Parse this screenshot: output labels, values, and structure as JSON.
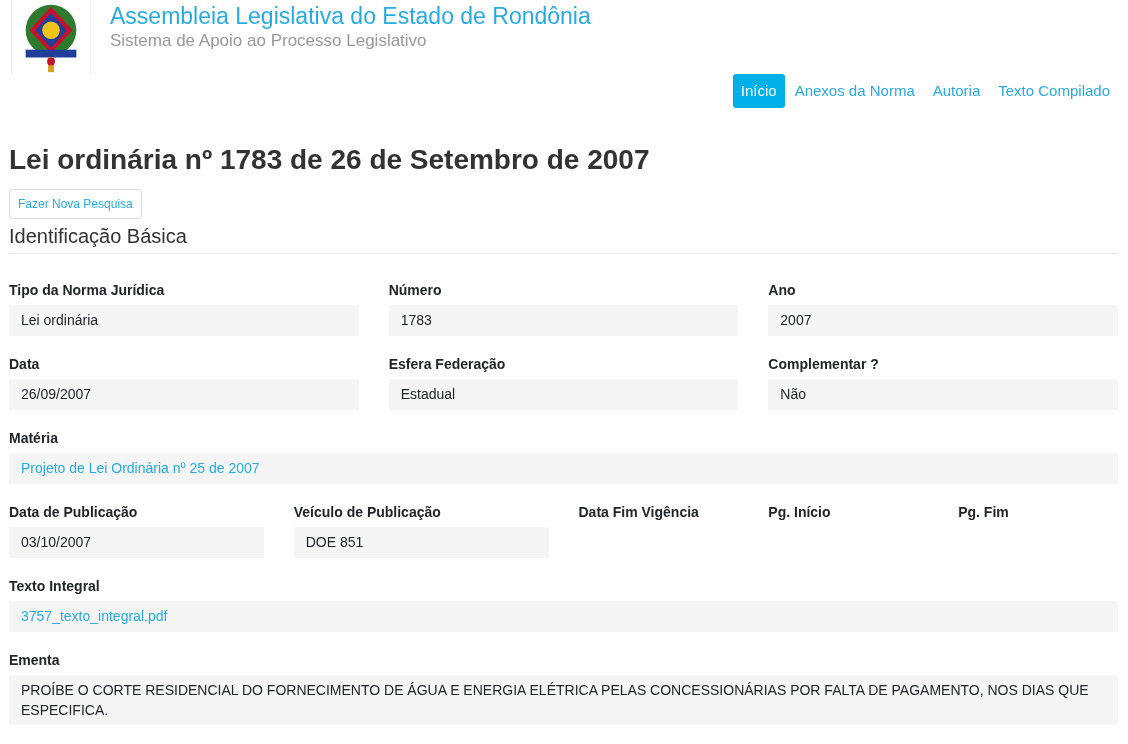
{
  "header": {
    "title": "Assembleia Legislativa do Estado de Rondônia",
    "subtitle": "Sistema de Apoio ao Processo Legislativo"
  },
  "nav": [
    {
      "label": "Início",
      "selected": true
    },
    {
      "label": "Anexos da Norma",
      "selected": false
    },
    {
      "label": "Autoria",
      "selected": false
    },
    {
      "label": "Texto Compilado",
      "selected": false
    }
  ],
  "page_title": "Lei ordinária nº 1783 de 26 de Setembro de 2007",
  "new_search_button": "Fazer Nova Pesquisa",
  "section_title": "Identificação Básica",
  "rows": [
    {
      "fields": [
        {
          "label": "Tipo da Norma Jurídica",
          "value": "Lei ordinária",
          "kind": "text"
        },
        {
          "label": "Número",
          "value": "1783",
          "kind": "text"
        },
        {
          "label": "Ano",
          "value": "2007",
          "kind": "text"
        }
      ]
    },
    {
      "fields": [
        {
          "label": "Data",
          "value": "26/09/2007",
          "kind": "text"
        },
        {
          "label": "Esfera Federação",
          "value": "Estadual",
          "kind": "text"
        },
        {
          "label": "Complementar ?",
          "value": "Não",
          "kind": "text"
        }
      ]
    },
    {
      "fields": [
        {
          "label": "Matéria",
          "value": "Projeto de Lei Ordinária nº 25 de 2007",
          "kind": "link"
        }
      ]
    },
    {
      "fields": [
        {
          "label": "Data de Publicação",
          "value": "03/10/2007",
          "kind": "text"
        },
        {
          "label": "Veículo de Publicação",
          "value": "DOE 851",
          "kind": "text"
        },
        {
          "label": "Data Fim Vigência"
        },
        {
          "label": "Pg. Início"
        },
        {
          "label": "Pg. Fim"
        }
      ]
    },
    {
      "fields": [
        {
          "label": "Texto Integral",
          "value": "3757_texto_integral.pdf",
          "kind": "link"
        }
      ]
    },
    {
      "fields": [
        {
          "label": "Ementa",
          "value": "PROÍBE O CORTE RESIDENCIAL DO FORNECIMENTO DE ÁGUA E ENERGIA ELÉTRICA PELAS CONCESSIONÁRIAS POR FALTA DE PAGAMENTO, NOS DIAS QUE ESPECIFICA.",
          "kind": "text"
        }
      ]
    }
  ]
}
